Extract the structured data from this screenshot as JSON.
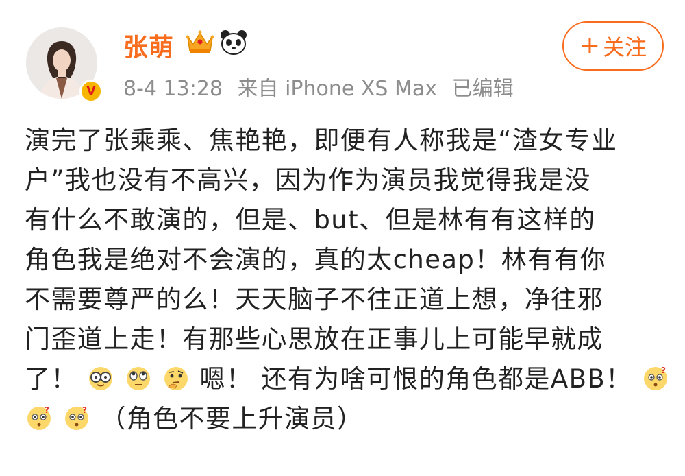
{
  "post": {
    "author": {
      "name": "张萌",
      "verified_badge": "V",
      "badges": [
        "crown-icon",
        "panda-icon"
      ]
    },
    "meta": {
      "time": "8-4 13:28",
      "source": "来自 iPhone XS Max",
      "edited": "已编辑"
    },
    "follow_button": {
      "plus": "+",
      "label": "关注"
    },
    "content": {
      "line1": "演完了张乘乘、焦艳艳，即便有人称我是“渣女专业",
      "line2": "户”我也没有不高兴，因为作为演员我觉得我是没",
      "line3": "有什么不敢演的，但是、but、但是林有有这样的",
      "line4": "角色我是绝对不会演的，真的太cheap！林有有你",
      "line5": "不需要尊严的么！天天脑子不往正道上想，净往邪",
      "line6": "门歪道上走！有那些心思放在正事儿上可能早就成",
      "line7a": "了！",
      "line7b": "嗯！ 还有为啥可恨的角色都是ABB！",
      "line8": "（角色不要上升演员）"
    },
    "emojis": [
      "glasses-face-icon",
      "rolling-eyes-icon",
      "thinking-face-icon",
      "confused-face-icon",
      "confused-face-icon",
      "confused-face-icon"
    ]
  },
  "colors": {
    "accent": "#f86c1d",
    "meta_text": "#8d8d8d",
    "body_text": "#222222"
  }
}
